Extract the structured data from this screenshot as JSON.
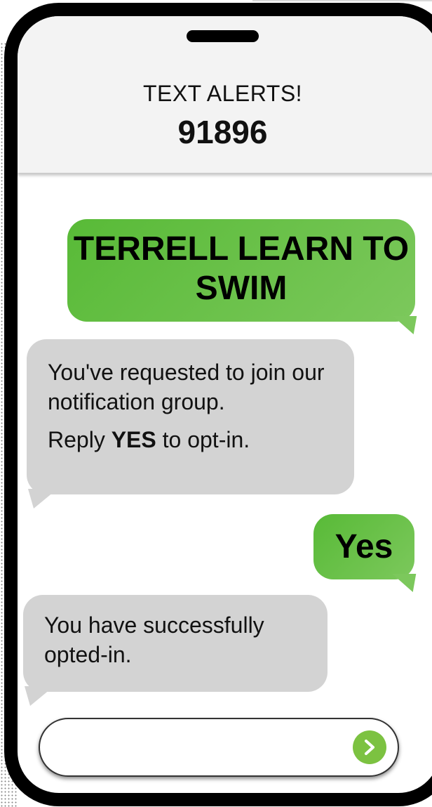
{
  "header": {
    "title": "TEXT ALERTS!",
    "short_code": "91896"
  },
  "messages": [
    {
      "sender": "user",
      "text": "TERRELL LEARN TO SWIM"
    },
    {
      "sender": "system",
      "line1": "You've requested to join our notification group.",
      "reply_prefix": "Reply ",
      "reply_keyword": "YES",
      "reply_suffix": " to opt-in."
    },
    {
      "sender": "user",
      "text": "Yes"
    },
    {
      "sender": "system",
      "text": "You have successfully opted-in."
    }
  ],
  "input": {
    "placeholder": "",
    "send_icon": "chevron-right-icon"
  },
  "colors": {
    "user_bubble": "#6ac04a",
    "system_bubble": "#d3d3d3",
    "send_button": "#7cc241",
    "frame": "#000000"
  }
}
